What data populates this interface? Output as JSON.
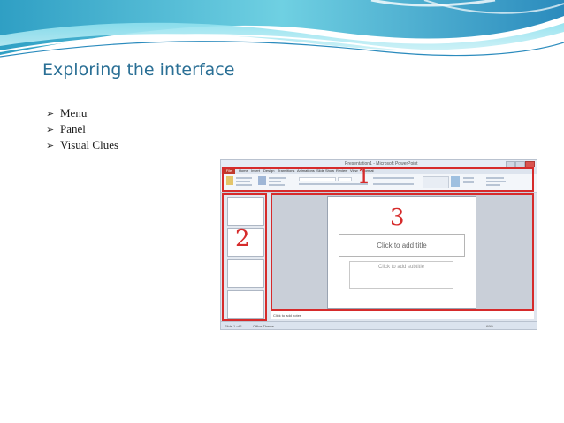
{
  "slide": {
    "title": "Exploring the interface",
    "bullets": [
      "Menu",
      "Panel",
      "Visual Clues"
    ],
    "bullet_glyph": "➢"
  },
  "screenshot": {
    "window_title": "Presentation1 - Microsoft PowerPoint",
    "tabs": [
      "File",
      "Home",
      "Insert",
      "Design",
      "Transitions",
      "Animations",
      "Slide Show",
      "Review",
      "View",
      "Format"
    ],
    "ribbon_label_paste": "Paste",
    "callouts": [
      "1",
      "2",
      "3"
    ],
    "title_placeholder": "Click to add title",
    "subtitle_placeholder": "Click to add subtitle",
    "notes_placeholder": "Click to add notes",
    "status_left": "Slide 1 of 1",
    "status_theme": "Office Theme",
    "zoom": "69%"
  },
  "colors": {
    "title": "#2a6f95",
    "callout": "#d62b2b",
    "wave_teal": "#5bc0d8"
  }
}
